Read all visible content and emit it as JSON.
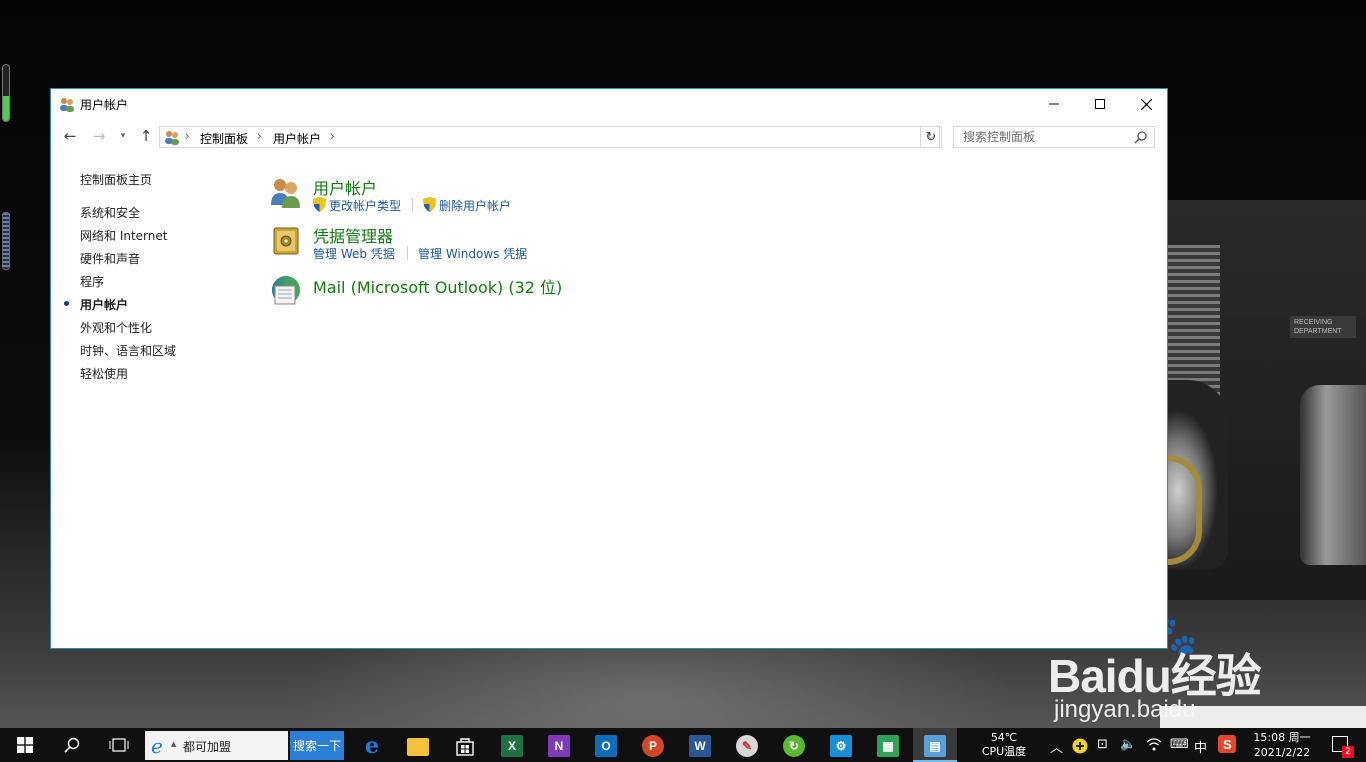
{
  "window": {
    "title": "用户帐户",
    "minimize_icon": "minimize-icon",
    "maximize_icon": "maximize-icon",
    "close_icon": "close-icon"
  },
  "navigation": {
    "breadcrumbs": [
      "控制面板",
      "用户帐户"
    ],
    "search_placeholder": "搜索控制面板"
  },
  "sidebar": {
    "home": "控制面板主页",
    "items": [
      {
        "label": "系统和安全",
        "active": false
      },
      {
        "label": "网络和 Internet",
        "active": false
      },
      {
        "label": "硬件和声音",
        "active": false
      },
      {
        "label": "程序",
        "active": false
      },
      {
        "label": "用户帐户",
        "active": true
      },
      {
        "label": "外观和个性化",
        "active": false
      },
      {
        "label": "时钟、语言和区域",
        "active": false
      },
      {
        "label": "轻松使用",
        "active": false
      }
    ]
  },
  "categories": [
    {
      "title": "用户帐户",
      "icon": "users-icon",
      "links": [
        "更改帐户类型",
        "删除用户帐户"
      ]
    },
    {
      "title": "凭据管理器",
      "icon": "vault-icon",
      "links": [
        "管理 Web 凭据",
        "管理 Windows 凭据"
      ]
    },
    {
      "title": "Mail (Microsoft Outlook) (32 位)",
      "icon": "mail-icon",
      "links": []
    }
  ],
  "colors": {
    "category_title": "#107c10",
    "link": "#1d5a9a",
    "window_border": "#2d8fb0",
    "taskbar": "#101010",
    "search_button": "#2b7fd8"
  },
  "taskbar": {
    "ie_text": "都可加盟",
    "search_button": "搜索一下",
    "apps": [
      "edge-icon",
      "file-explorer-icon",
      "store-icon",
      "excel-icon",
      "onenote-icon",
      "outlook-icon",
      "powerpoint-icon",
      "word-icon",
      "paint-icon",
      "refresh-app-icon",
      "settings-icon",
      "photos-icon",
      "control-panel-icon"
    ],
    "cpu_temp": "54℃",
    "cpu_label": "CPU温度",
    "ime": "中",
    "time": "15:08 周一",
    "date": "2021/2/22",
    "notification_count": "2"
  },
  "watermark": {
    "brand": "Baidu经验",
    "site": "jingyan.baidu"
  },
  "wallpaper_sign": "RECEIVING DEPARTMENT"
}
